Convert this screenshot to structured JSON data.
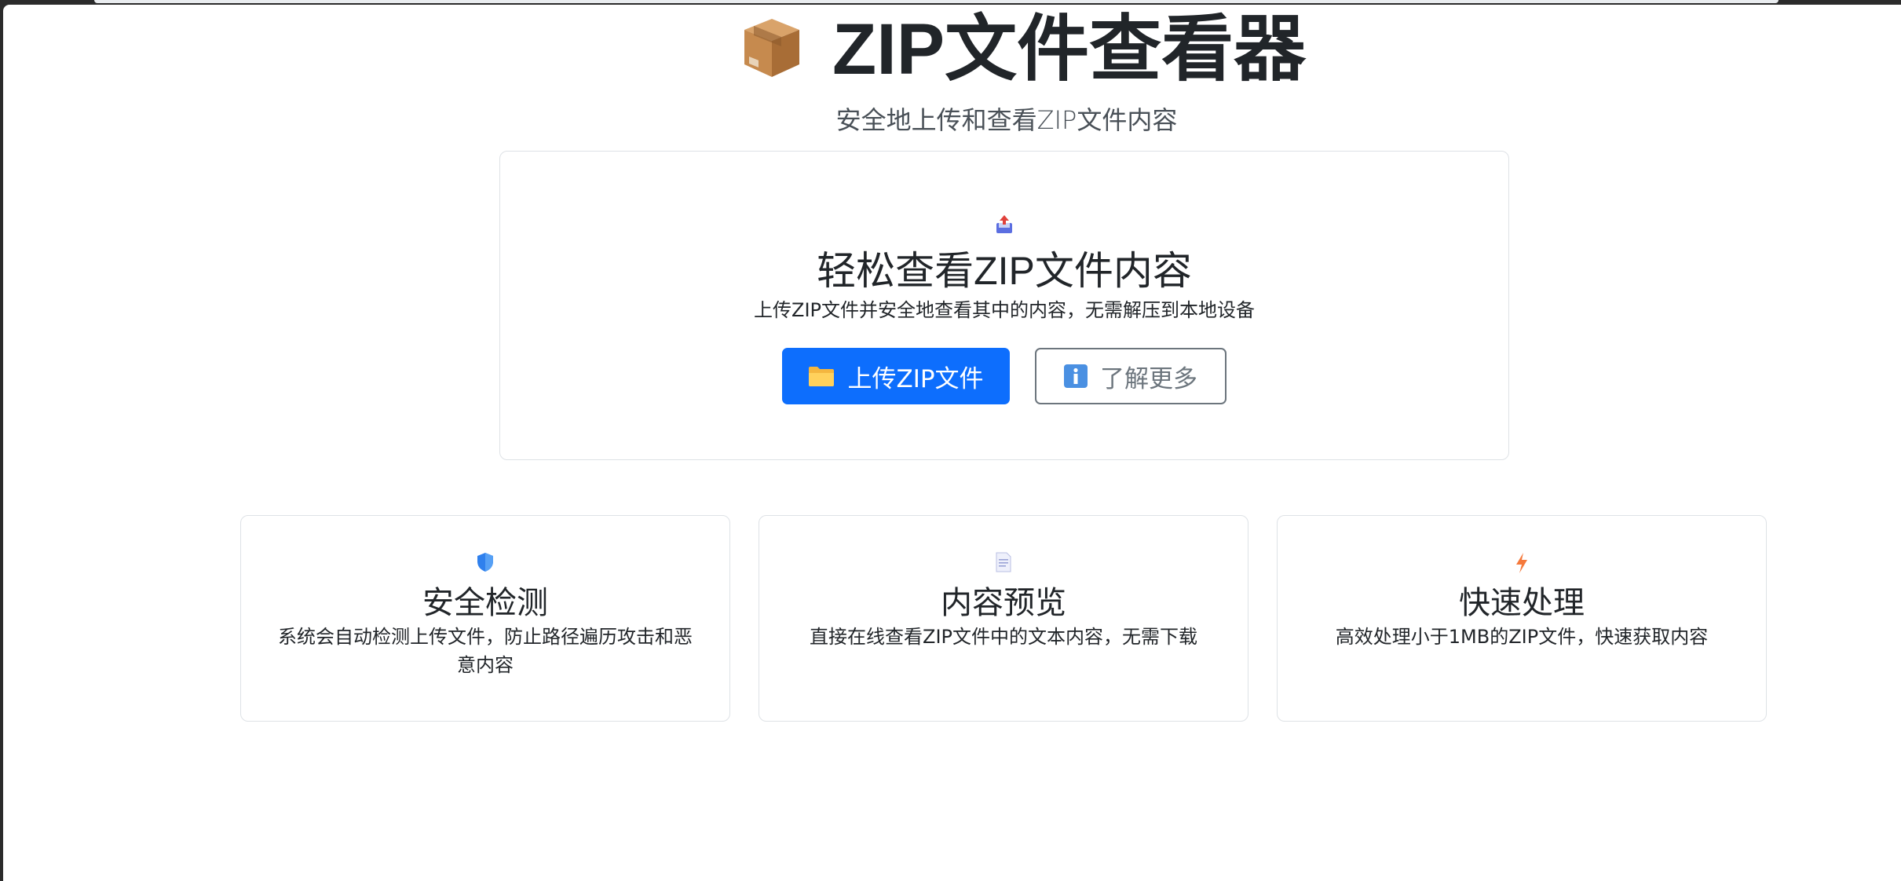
{
  "header": {
    "title": "ZIP文件查看器",
    "subtitle": "安全地上传和查看ZIP文件内容",
    "logo_icon": "package-box-icon"
  },
  "hero": {
    "icon": "upload-inbox-icon",
    "title": "轻松查看ZIP文件内容",
    "description": "上传ZIP文件并安全地查看其中的内容，无需解压到本地设备",
    "upload_button": {
      "label": "上传ZIP文件",
      "icon": "folder-icon"
    },
    "learn_more_button": {
      "label": "了解更多",
      "icon": "info-icon"
    }
  },
  "features": [
    {
      "icon": "shield-icon",
      "title": "安全检测",
      "description": "系统会自动检测上传文件，防止路径遍历攻击和恶意内容"
    },
    {
      "icon": "document-icon",
      "title": "内容预览",
      "description": "直接在线查看ZIP文件中的文本内容，无需下载"
    },
    {
      "icon": "lightning-icon",
      "title": "快速处理",
      "description": "高效处理小于1MB的ZIP文件，快速获取内容"
    }
  ],
  "colors": {
    "primary": "#0d6efd",
    "secondary": "#6c757d",
    "border": "#dee2e6",
    "text": "#212529"
  }
}
